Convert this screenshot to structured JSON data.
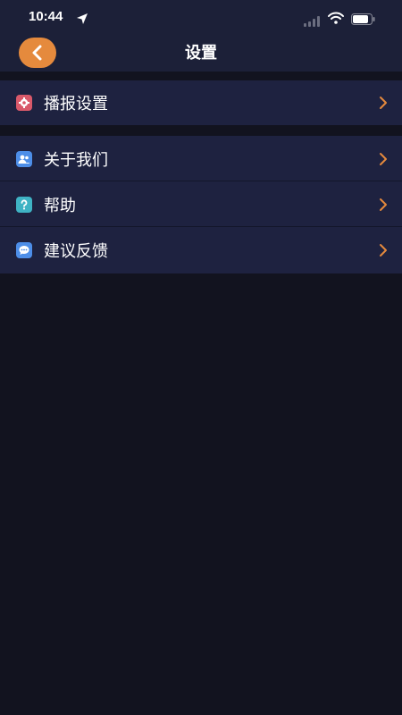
{
  "status_bar": {
    "time": "10:44",
    "icons": [
      "location-arrow-icon",
      "signal-icon",
      "wifi-icon",
      "battery-icon"
    ]
  },
  "nav": {
    "title": "设置",
    "back_icon": "chevron-left-icon"
  },
  "groups": [
    {
      "items": [
        {
          "label": "播报设置",
          "icon": "gear-icon"
        }
      ]
    },
    {
      "items": [
        {
          "label": "关于我们",
          "icon": "people-icon"
        },
        {
          "label": "帮助",
          "icon": "question-icon"
        },
        {
          "label": "建议反馈",
          "icon": "chat-bubble-icon"
        }
      ]
    }
  ],
  "colors": {
    "background": "#12131f",
    "bar": "#1c2038",
    "row": "#1e2240",
    "accent": "#e58a3d"
  }
}
